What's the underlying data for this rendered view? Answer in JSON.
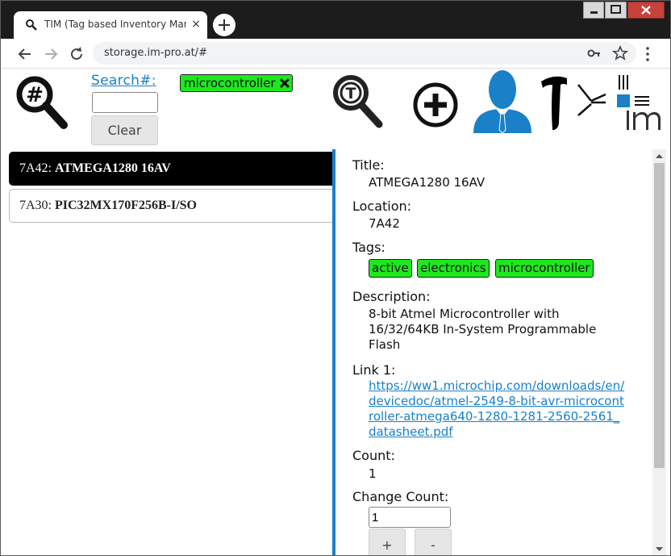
{
  "browser": {
    "tab_title": "TIM (Tag based Inventory Management)",
    "tab_close": "×",
    "url": "storage.im-pro.at/#"
  },
  "header": {
    "search_label": "Search#:",
    "search_value": "",
    "clear_label": "Clear",
    "filter_tag": "microcontroller"
  },
  "list": {
    "items": [
      {
        "location": "7A42:",
        "title": "ATMEGA1280 16AV",
        "selected": true
      },
      {
        "location": "7A30:",
        "title": "PIC32MX170F256B-I/SO",
        "selected": false
      }
    ]
  },
  "detail": {
    "title_label": "Title:",
    "title_value": "ATMEGA1280 16AV",
    "location_label": "Location:",
    "location_value": "7A42",
    "tags_label": "Tags:",
    "tags": [
      "active",
      "electronics",
      "microcontroller"
    ],
    "description_label": "Description:",
    "description_lines": [
      "8-bit Atmel Microcontroller with",
      "16/32/64KB In-System Programmable",
      "Flash"
    ],
    "link1_label": "Link 1:",
    "link1_lines": [
      "https://ww1.microchip.com/downloads/en/",
      "devicedoc/atmel-2549-8-bit-avr-microcont",
      "roller-atmega640-1280-1281-2560-2561_",
      "datasheet.pdf"
    ],
    "count_label": "Count:",
    "count_value": "1",
    "change_count_label": "Change Count:",
    "change_count_value": "1",
    "plus_label": "+",
    "minus_label": "-"
  },
  "colors": {
    "accent": "#1a80c8",
    "tag_green": "#1de91d",
    "selected_bg": "#000000"
  }
}
